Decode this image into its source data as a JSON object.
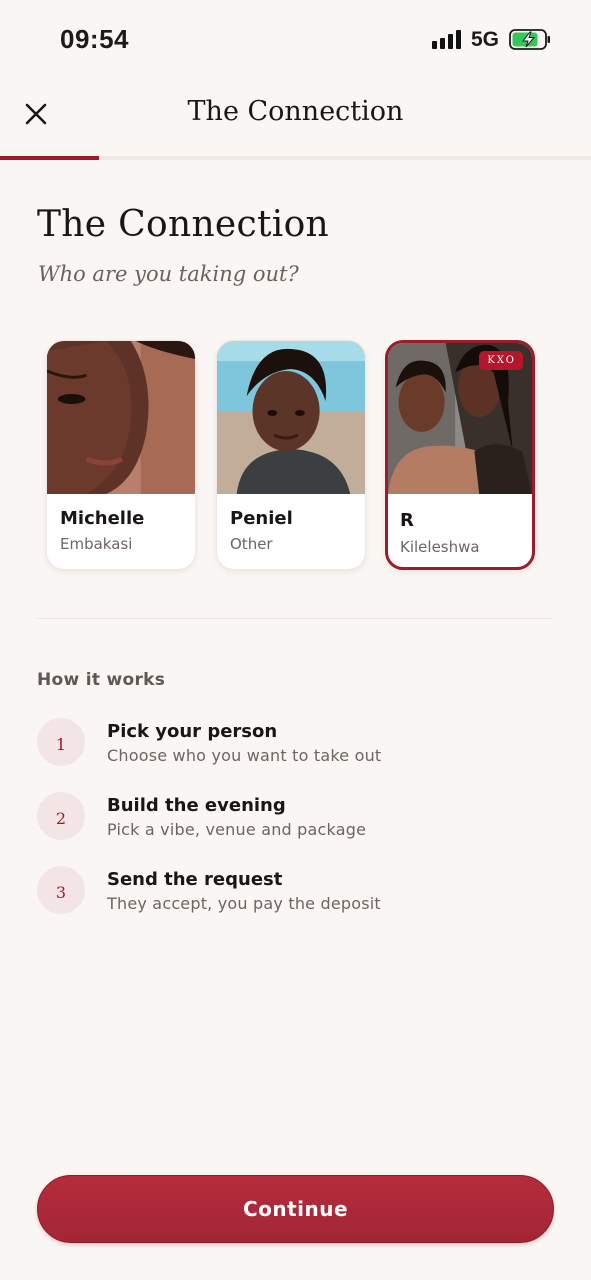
{
  "status_bar": {
    "time": "09:54",
    "network": "5G",
    "battery_charging": true
  },
  "header": {
    "title": "The Connection",
    "progress_fraction": 0.167
  },
  "page": {
    "title": "The Connection",
    "subtitle": "Who are you taking out?"
  },
  "people": [
    {
      "name": "Michelle",
      "area": "Embakasi",
      "selected": false,
      "badge": ""
    },
    {
      "name": "Peniel",
      "area": "Other",
      "selected": false,
      "badge": ""
    },
    {
      "name": "R",
      "area": "Kileleshwa",
      "selected": true,
      "badge": "KXO"
    }
  ],
  "how_it_works": {
    "heading": "How it works",
    "steps": [
      {
        "num": "1",
        "title": "Pick your person",
        "desc": "Choose who you want to take out"
      },
      {
        "num": "2",
        "title": "Build the evening",
        "desc": "Pick a vibe, venue and package"
      },
      {
        "num": "3",
        "title": "Send the request",
        "desc": "They accept, you pay the deposit"
      }
    ]
  },
  "continue_label": "Continue",
  "colors": {
    "accent": "#9b1c2b",
    "background": "#faf6f3",
    "button": "#aa2a3a"
  },
  "icons": {
    "close": "close-icon",
    "signal": "signal-icon",
    "battery": "battery-charging-icon"
  }
}
